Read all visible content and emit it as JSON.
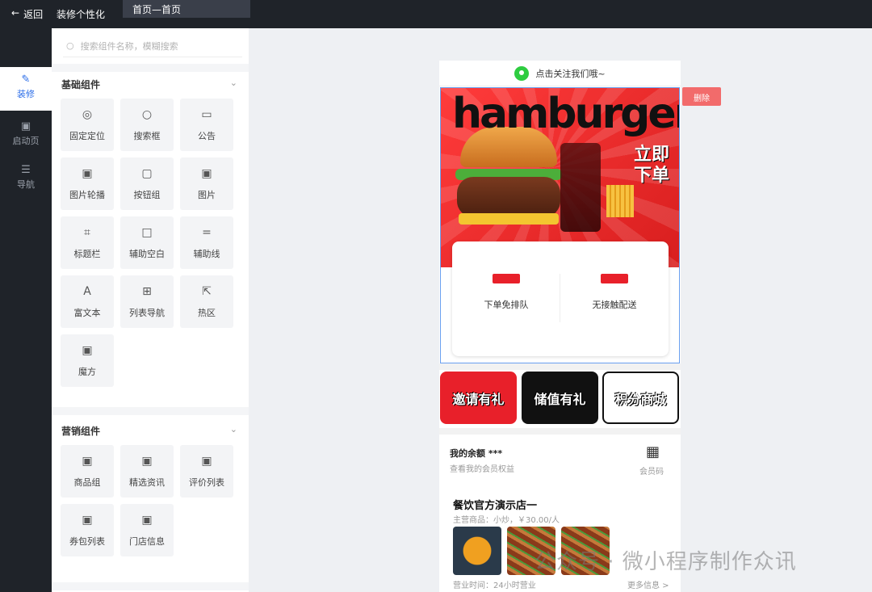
{
  "topbar": {
    "back_label": "返回",
    "title": "装修个性化",
    "active_tab": "首页—首页"
  },
  "leftnav": [
    {
      "label": "装修",
      "icon": "edit-icon"
    },
    {
      "label": "启动页",
      "icon": "ad-icon"
    },
    {
      "label": "导航",
      "icon": "list-icon"
    }
  ],
  "panel": {
    "search_placeholder": "搜索组件名称，模糊搜索",
    "basic": {
      "title": "基础组件",
      "items": [
        "固定定位",
        "搜索框",
        "公告",
        "图片轮播",
        "按钮组",
        "图片",
        "标题栏",
        "辅助空白",
        "辅助线",
        "富文本",
        "列表导航",
        "热区",
        "魔方"
      ]
    },
    "marketing": {
      "title": "营销组件",
      "items": [
        "商品组",
        "精选资讯",
        "评价列表",
        "券包列表",
        "门店信息"
      ]
    }
  },
  "phone": {
    "follow_text": "点击关注我们哦~",
    "banner_title": "hamburger",
    "banner_cta": [
      "立即",
      "下单"
    ],
    "card": [
      {
        "label": "下单免排队"
      },
      {
        "label": "无接触配送"
      }
    ],
    "promos": [
      "邀请有礼",
      "储值有礼",
      "积分商城"
    ],
    "balance_title": "我的余额 ***",
    "balance_sub": "查看我的会员权益",
    "qr_label": "会员码",
    "store_name": "餐饮官方演示店一",
    "store_sub": "主营商品：小炒，￥30.00/人",
    "hours": "营业时间：24小时营业",
    "more": "更多信息 >"
  },
  "delete_label": "删除",
  "watermark": "公众号 · 微小程序制作众讯"
}
